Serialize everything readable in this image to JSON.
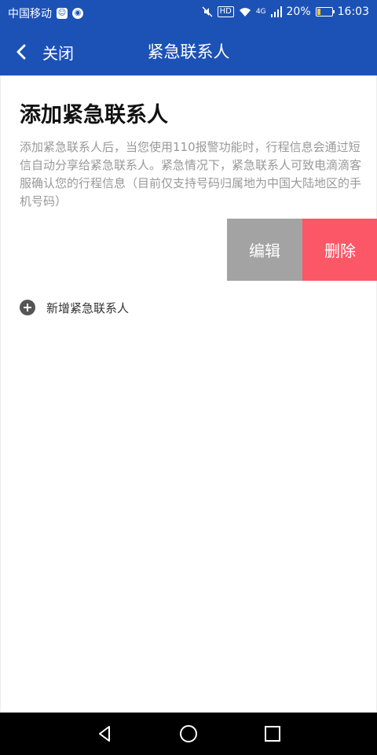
{
  "status_bar": {
    "carrier": "中国移动",
    "network": "4G",
    "battery": "20%",
    "battery_level": 0.2,
    "time": "16:03"
  },
  "nav": {
    "back_label": "关闭",
    "title": "紧急联系人"
  },
  "page": {
    "title": "添加紧急联系人",
    "description": "添加紧急联系人后，当您使用110报警功能时，行程信息会通过短信自动分享给紧急联系人。紧急情况下，紧急联系人可致电滴滴客服确认您的行程信息（目前仅支持号码归属地为中国大陆地区的手机号码）"
  },
  "contact_actions": {
    "edit_label": "编辑",
    "delete_label": "删除"
  },
  "add_contact": {
    "label": "新增紧急联系人"
  },
  "colors": {
    "header_bg": "#1c52b6",
    "edit_bg": "#a3a3a3",
    "delete_bg": "#fb5766"
  },
  "icons": {
    "back": "chevron-left-icon",
    "add": "plus-circle-icon",
    "sys_back": "triangle-back-icon",
    "sys_home": "circle-home-icon",
    "sys_recent": "square-recent-icon"
  }
}
